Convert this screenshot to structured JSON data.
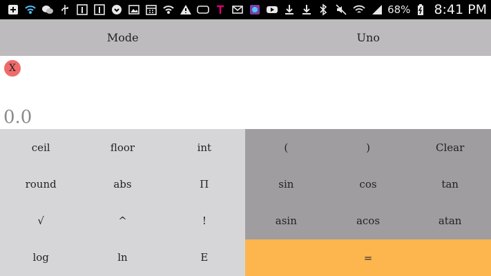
{
  "status_bar": {
    "battery": "68%",
    "time": "8:41 PM",
    "left_icons": [
      "add-box-icon",
      "wifi-calling-icon",
      "chat-icon",
      "usb-icon",
      "one-icon",
      "one-icon",
      "heart-icon",
      "image-icon",
      "calendar-icon",
      "signal-icon",
      "warning-icon",
      "voicemail-icon",
      "t-mobile-icon",
      "mail-icon",
      "app-icon",
      "youtube-icon",
      "download-icon",
      "download-icon"
    ],
    "right_icons": [
      "bluetooth-icon",
      "mute-icon",
      "wifi-icon",
      "signal-bars-icon"
    ]
  },
  "topbar": {
    "mode_label": "Mode",
    "uno_label": "Uno"
  },
  "display": {
    "close_label": "X",
    "result": "0.0"
  },
  "keys_left": [
    "ceil",
    "floor",
    "int",
    "round",
    "abs",
    "Π",
    "√",
    "^",
    "!",
    "log",
    "ln",
    "E"
  ],
  "keys_right": [
    "(",
    ")",
    "Clear",
    "sin",
    "cos",
    "tan",
    "asin",
    "acos",
    "atan"
  ],
  "equals_label": "=",
  "colors": {
    "topbar": "#bdbbbd",
    "left_pad": "#d6d5d7",
    "right_pad": "#9f9d9f",
    "equals": "#fdb64e",
    "close_button": "#ef6b6b"
  }
}
